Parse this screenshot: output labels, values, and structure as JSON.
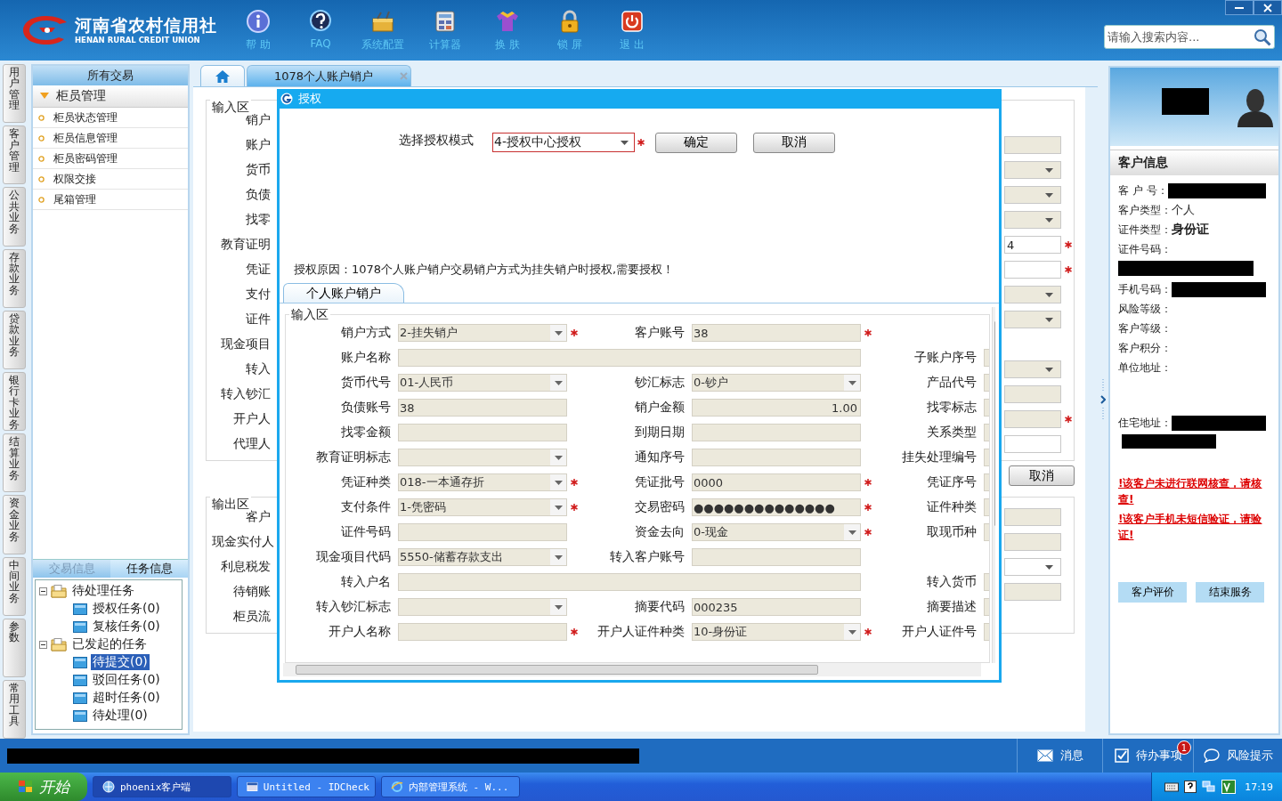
{
  "header": {
    "logo_title": "河南省农村信用社",
    "logo_subtitle": "HENAN RURAL CREDIT UNION",
    "toolbar": [
      {
        "label": "帮 助",
        "kind": "help"
      },
      {
        "label": "FAQ",
        "kind": "faq"
      },
      {
        "label": "系统配置",
        "kind": "settings"
      },
      {
        "label": "计算器",
        "kind": "calculator"
      },
      {
        "label": "换 肤",
        "kind": "skin"
      },
      {
        "label": "锁 屏",
        "kind": "lock"
      },
      {
        "label": "退 出",
        "kind": "exit"
      }
    ],
    "search": {
      "placeholder": "请输入搜索内容..."
    }
  },
  "side_tabs": [
    "用户管理",
    "客户管理",
    "公共业务",
    "存款业务",
    "贷款业务",
    "银行卡业务",
    "结算业务",
    "资金业务",
    "中间业务",
    "参数",
    "常用工具"
  ],
  "nav": {
    "title": "所有交易",
    "group": {
      "label": "柜员管理",
      "expanded": true,
      "items": [
        "柜员状态管理",
        "柜员信息管理",
        "柜员密码管理",
        "权限交接",
        "尾箱管理"
      ]
    }
  },
  "task_panel": {
    "tabs": [
      {
        "label": "交易信息",
        "selected": false
      },
      {
        "label": "任务信息",
        "selected": true
      }
    ],
    "tree": [
      {
        "label": "待处理任务",
        "expanded": true,
        "selected": false,
        "children": [
          {
            "label": "授权任务(0)",
            "selected": false
          },
          {
            "label": "复核任务(0)",
            "selected": false
          }
        ]
      },
      {
        "label": "已发起的任务",
        "expanded": true,
        "selected": false,
        "children": [
          {
            "label": "待提交(0)",
            "selected": true
          },
          {
            "label": "驳回任务(0)",
            "selected": false
          },
          {
            "label": "超时任务(0)",
            "selected": false
          },
          {
            "label": "待处理(0)",
            "selected": false
          }
        ]
      }
    ]
  },
  "tabs": [
    {
      "kind": "home",
      "selected": false
    },
    {
      "kind": "page",
      "label": "1078个人账户销户",
      "selected": true
    }
  ],
  "background_form": {
    "input_legend": "输入区",
    "input_rows": [
      {
        "label": "销户",
        "kind": "blank"
      },
      {
        "label": "账户",
        "kind": "text",
        "disabled": true,
        "required": false
      },
      {
        "label": "货币",
        "kind": "select",
        "disabled": true,
        "required": false
      },
      {
        "label": "负债",
        "kind": "select",
        "disabled": true,
        "required": false
      },
      {
        "label": "找零",
        "kind": "select",
        "disabled": true,
        "required": false
      },
      {
        "label": "教育证明",
        "kind": "text",
        "disabled": false,
        "required": true,
        "value": "4"
      },
      {
        "label": "凭证",
        "kind": "text",
        "disabled": false,
        "required": true
      },
      {
        "label": "支付",
        "kind": "select",
        "disabled": true,
        "required": false
      },
      {
        "label": "证件",
        "kind": "select",
        "disabled": true,
        "required": false
      },
      {
        "label": "现金项目",
        "kind": "blank"
      },
      {
        "label": "转入",
        "kind": "select",
        "disabled": true,
        "required": false
      },
      {
        "label": "转入钞汇",
        "kind": "text",
        "disabled": true,
        "required": false
      },
      {
        "label": "开户人",
        "kind": "text",
        "disabled": true,
        "required": true
      },
      {
        "label": "代理人",
        "kind": "text",
        "disabled": false,
        "required": false
      }
    ],
    "cancel_button": "取消",
    "output_legend": "输出区",
    "output_rows": [
      {
        "label": "客户",
        "kind": "text",
        "disabled": true,
        "required": false
      },
      {
        "label": "现金实付人",
        "kind": "text",
        "disabled": true,
        "required": false
      },
      {
        "label": "利息税发",
        "kind": "select",
        "disabled": false,
        "required": false
      },
      {
        "label": "待销账",
        "kind": "text",
        "disabled": true,
        "required": false
      },
      {
        "label": "柜员流",
        "kind": "blank"
      }
    ]
  },
  "dialog": {
    "title": "授权",
    "mode_label": "选择授权模式",
    "mode_value": "4-授权中心授权",
    "mode_required": true,
    "buttons": [
      "确定",
      "取消"
    ],
    "reason": "授权原因：1078个人账户销户交易销户方式为挂失销户时授权,需要授权！",
    "tab": "个人账户销户",
    "legend": "输入区",
    "rows": [
      [
        {
          "label": "销户方式",
          "kind": "select",
          "value": "2-挂失销户",
          "required": true
        },
        {
          "label": "客户账号",
          "kind": "text",
          "value": "38",
          "required": true
        }
      ],
      [
        {
          "label": "账户名称",
          "kind": "wide",
          "required": false
        },
        {
          "label": "子账户序号",
          "kind": "stub"
        }
      ],
      [
        {
          "label": "货币代号",
          "kind": "select",
          "value": "01-人民币",
          "required": false
        },
        {
          "label": "钞汇标志",
          "kind": "select",
          "value": "0-钞户",
          "required": false
        },
        {
          "label": "产品代号",
          "kind": "stub"
        }
      ],
      [
        {
          "label": "负债账号",
          "kind": "text",
          "value": "38",
          "required": false
        },
        {
          "label": "销户金额",
          "kind": "amount",
          "value": "1.00",
          "required": false
        },
        {
          "label": "找零标志",
          "kind": "stub"
        }
      ],
      [
        {
          "label": "找零金额",
          "kind": "text",
          "required": false
        },
        {
          "label": "到期日期",
          "kind": "text",
          "required": false
        },
        {
          "label": "关系类型",
          "kind": "stub"
        }
      ],
      [
        {
          "label": "教育证明标志",
          "kind": "select",
          "required": false
        },
        {
          "label": "通知序号",
          "kind": "text",
          "required": false
        },
        {
          "label": "挂失处理编号",
          "kind": "stub"
        }
      ],
      [
        {
          "label": "凭证种类",
          "kind": "select",
          "value": "018-一本通存折",
          "required": true
        },
        {
          "label": "凭证批号",
          "kind": "text",
          "value": "0000",
          "required": true
        },
        {
          "label": "凭证序号",
          "kind": "stub"
        }
      ],
      [
        {
          "label": "支付条件",
          "kind": "select",
          "value": "1-凭密码",
          "required": true
        },
        {
          "label": "交易密码",
          "kind": "text",
          "value": "●●●●●●●●●●●●●●",
          "required": true
        },
        {
          "label": "证件种类",
          "kind": "stub"
        }
      ],
      [
        {
          "label": "证件号码",
          "kind": "text",
          "required": false
        },
        {
          "label": "资金去向",
          "kind": "select",
          "value": "0-现金",
          "required": true
        },
        {
          "label": "取现币种",
          "kind": "stub"
        }
      ],
      [
        {
          "label": "现金项目代码",
          "kind": "select",
          "value": "5550-储蓄存款支出",
          "required": false
        },
        {
          "label": "转入客户账号",
          "kind": "text",
          "required": false
        }
      ],
      [
        {
          "label": "转入户名",
          "kind": "wide",
          "required": false
        },
        {
          "label": "转入货币",
          "kind": "stub"
        }
      ],
      [
        {
          "label": "转入钞汇标志",
          "kind": "select",
          "required": false
        },
        {
          "label": "摘要代码",
          "kind": "text",
          "value": "000235",
          "required": false
        },
        {
          "label": "摘要描述",
          "kind": "stub"
        }
      ],
      [
        {
          "label": "开户人名称",
          "kind": "text",
          "required": true
        },
        {
          "label": "开户人证件种类",
          "kind": "select",
          "value": "10-身份证",
          "required": true
        },
        {
          "label": "开户人证件号",
          "kind": "stub"
        }
      ]
    ]
  },
  "customer_panel": {
    "title": "客户信息",
    "fields": [
      {
        "label": "客 户 号：",
        "kind": "redacted"
      },
      {
        "label": "客户类型：",
        "kind": "text",
        "value": "个人"
      },
      {
        "label": "证件类型：",
        "kind": "bold",
        "value": "身份证"
      },
      {
        "label": "证件号码：",
        "kind": "redacted_below"
      },
      {
        "label": "手机号码：",
        "kind": "redacted"
      },
      {
        "label": "风险等级：",
        "kind": "empty"
      },
      {
        "label": "客户等级：",
        "kind": "empty"
      },
      {
        "label": "客户积分：",
        "kind": "empty"
      },
      {
        "label": "单位地址：",
        "kind": "empty"
      },
      {
        "label": "住宅地址：",
        "kind": "address"
      }
    ],
    "warnings": [
      "!该客户未进行联网核查，请核查!",
      "!该客户手机未短信验证，请验证!"
    ],
    "buttons": [
      "客户评价",
      "结束服务"
    ]
  },
  "status_bar": {
    "items": [
      {
        "label": "消息",
        "kind": "message"
      },
      {
        "label": "待办事项",
        "kind": "todo",
        "badge": "1"
      },
      {
        "label": "风险提示",
        "kind": "risk"
      }
    ]
  },
  "taskbar": {
    "start": "开始",
    "tasks": [
      {
        "label": "phoenix客户端",
        "kind": "app",
        "selected": true
      },
      {
        "label": "Untitled - IDCheck",
        "kind": "window",
        "selected": false
      },
      {
        "label": "内部管理系统 - W...",
        "kind": "browser",
        "selected": false
      }
    ],
    "time": "17:19"
  }
}
